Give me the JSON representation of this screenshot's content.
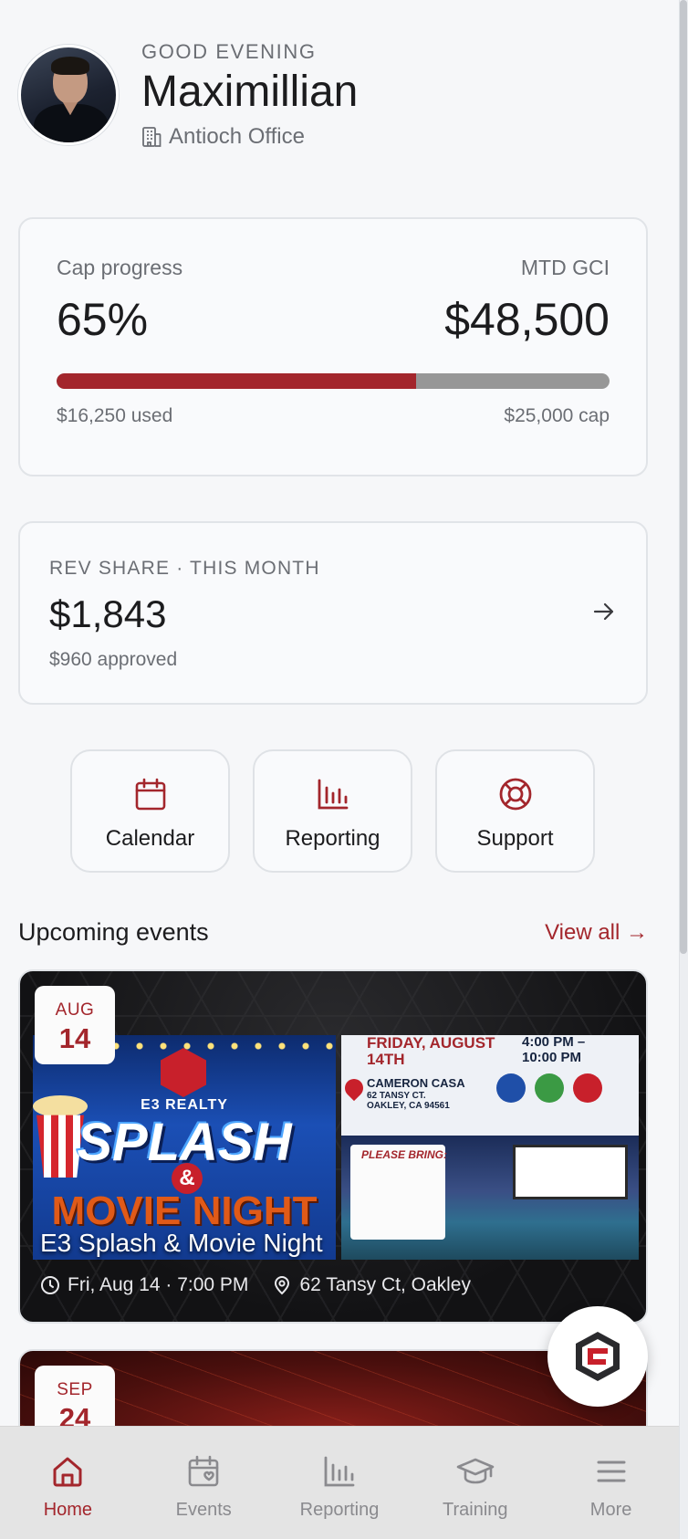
{
  "header": {
    "greeting": "GOOD EVENING",
    "name": "Maximillian",
    "office": "Antioch Office"
  },
  "cap": {
    "label": "Cap progress",
    "percent_text": "65%",
    "progress_fraction": 0.65,
    "gci_label": "MTD GCI",
    "gci_value": "$48,500",
    "used_text": "$16,250 used",
    "cap_text": "$25,000 cap"
  },
  "rev_share": {
    "label": "REV SHARE · THIS MONTH",
    "value": "$1,843",
    "approved": "$960 approved"
  },
  "quick_actions": [
    {
      "label": "Calendar",
      "icon": "calendar-icon"
    },
    {
      "label": "Reporting",
      "icon": "bar-chart-icon"
    },
    {
      "label": "Support",
      "icon": "lifebuoy-icon"
    }
  ],
  "events": {
    "title": "Upcoming events",
    "view_all": "View all →",
    "items": [
      {
        "month": "AUG",
        "day": "14",
        "title": "E3 Splash & Movie Night",
        "when": "Fri, Aug 14 · 7:00 PM",
        "where": "62 Tansy Ct, Oakley"
      },
      {
        "month": "SEP",
        "day": "24"
      }
    ]
  },
  "poster": {
    "brand": "E3 REALTY",
    "splash": "SPLASH",
    "amp": "&",
    "movie": "MOVIE NIGHT",
    "friday": "FRIDAY, AUGUST 14TH",
    "time": "4:00 PM – 10:00 PM",
    "venue": "CAMERON CASA",
    "address1": "62 TANSY CT.",
    "address2": "OAKLEY, CA 94561",
    "bring": "PLEASE BRING:"
  },
  "nav": [
    {
      "label": "Home",
      "icon": "home-icon",
      "active": true
    },
    {
      "label": "Events",
      "icon": "calendar-heart-icon"
    },
    {
      "label": "Reporting",
      "icon": "bar-chart-icon"
    },
    {
      "label": "Training",
      "icon": "graduation-cap-icon"
    },
    {
      "label": "More",
      "icon": "menu-icon"
    }
  ],
  "colors": {
    "accent": "#a3262c",
    "track": "#979797",
    "background": "#f6f7f9"
  }
}
